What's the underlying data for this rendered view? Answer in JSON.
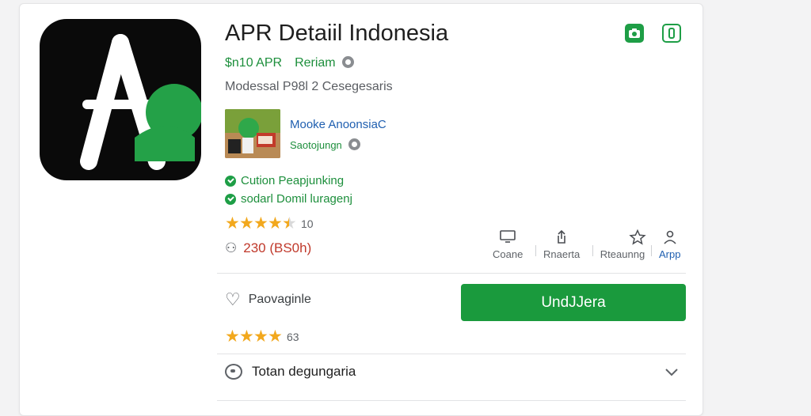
{
  "app": {
    "title": "APR Detaiil Indonesia",
    "price": "$n10 APR",
    "developer": "Reriam",
    "meta": "Modessal  P98l 2 Cesegesaris"
  },
  "featured": {
    "title": "Mooke AnoonsiaC",
    "subtitle": "Saotojungn"
  },
  "checks": [
    "Cution Peapjunking",
    "sodarl Domil luragenj"
  ],
  "rating": {
    "stars": 4.5,
    "count": "10"
  },
  "downloads": "230 (BS0h)",
  "actions": [
    {
      "icon": "screen-icon",
      "label": "Coane"
    },
    {
      "icon": "share-icon",
      "label": "Rnaerta"
    },
    {
      "icon": "star-outline-icon",
      "label": "Rteaunng"
    },
    {
      "icon": "person-icon",
      "label": "Arpp"
    }
  ],
  "wishlist_label": "Paovaginle",
  "install_label": "UndJJera",
  "user_rating": {
    "stars": 4,
    "count": "63"
  },
  "reviews_label": "Totan degungaria",
  "colors": {
    "accent": "#1a9a3d",
    "star": "#f2a81d",
    "link": "#1f5fb0",
    "download": "#c0392b"
  }
}
